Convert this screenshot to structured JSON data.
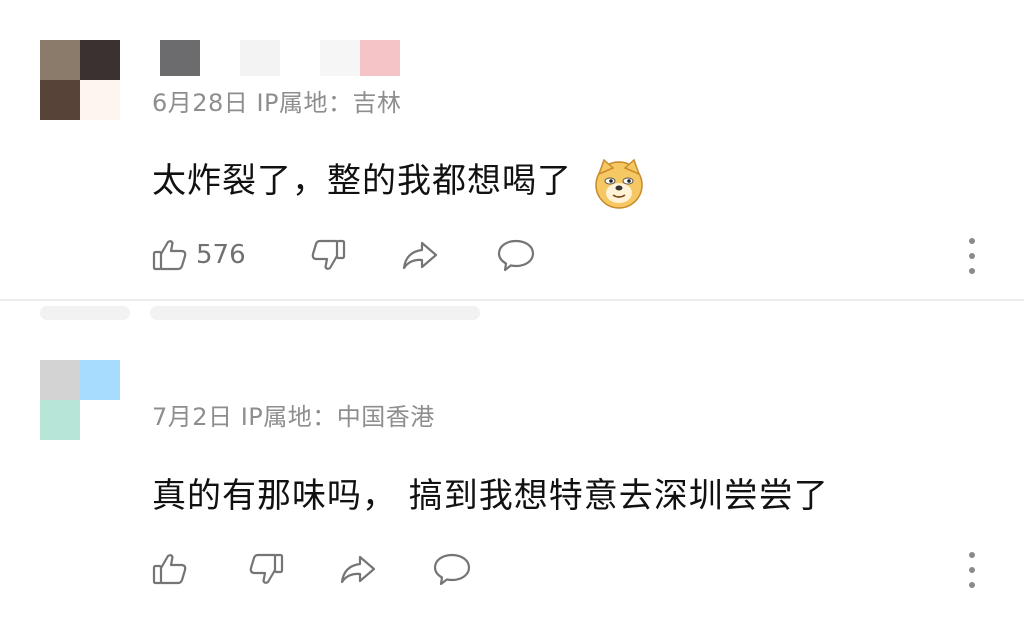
{
  "comments": [
    {
      "avatar_colors": [
        "#8b7b6a",
        "#3a3230",
        "#574338",
        "#fdf6ef"
      ],
      "username_colors": [
        "#6c6c6e",
        "#f3f3f3",
        "#f6f6f6",
        "#f4c4c6"
      ],
      "date": "6月28日",
      "ip_location": "IP属地：吉林",
      "text": "太炸裂了，整的我都想喝了",
      "emoji_icon": "doge-icon",
      "like_count": "576"
    },
    {
      "avatar_colors": [
        "#d3d3d3",
        "#a8dcff",
        "#b7e6d8",
        "#ffffff"
      ],
      "date": "7月2日",
      "ip_location": "IP属地：中国香港",
      "text": "真的有那味吗， 搞到我想特意去深圳尝尝了",
      "like_count": ""
    }
  ],
  "icons": {
    "like": "thumbs-up-icon",
    "dislike": "thumbs-down-icon",
    "share": "share-arrow-icon",
    "reply": "comment-bubble-icon",
    "more": "more-vertical-icon"
  }
}
